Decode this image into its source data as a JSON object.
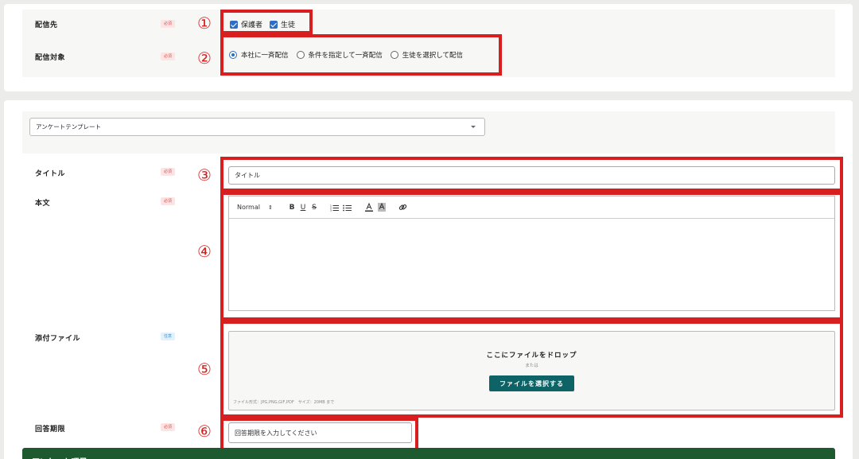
{
  "delivery": {
    "destination_label": "配信先",
    "destination_badge": "必須",
    "checkbox_guardian": "保護者",
    "checkbox_student": "生徒",
    "target_label": "配信対象",
    "target_badge": "必須",
    "radio_all": "本社に一斉配信",
    "radio_condition": "条件を指定して一斉配信",
    "radio_select": "生徒を選択して配信"
  },
  "template": {
    "selected": "アンケートテンプレート"
  },
  "form": {
    "title_label": "タイトル",
    "title_badge": "必須",
    "title_value": "タイトル",
    "body_label": "本文",
    "body_badge": "必須",
    "attach_label": "添付ファイル",
    "attach_badge": "任意",
    "deadline_label": "回答期限",
    "deadline_badge": "必須",
    "deadline_placeholder": "回答期限を入力してください"
  },
  "editor": {
    "format_select": "Normal",
    "format_arrows": "⇕",
    "bold": "B",
    "underline": "U",
    "strike": "S"
  },
  "upload": {
    "drop_title": "ここにファイルをドロップ",
    "or_text": "または",
    "select_button": "ファイルを選択する",
    "note": "ファイル形式：JPG,PNG,GIF,PDF　サイズ：20MB まで"
  },
  "annotations": {
    "n1": "①",
    "n2": "②",
    "n3": "③",
    "n4": "④",
    "n5": "⑤",
    "n6": "⑥"
  },
  "section": {
    "next_title": "アンケート項目"
  },
  "colors": {
    "accent_red": "#d81e1e",
    "checkbox_blue": "#2f6ec4",
    "button_teal": "#0e6366",
    "section_green": "#1e5a30"
  }
}
